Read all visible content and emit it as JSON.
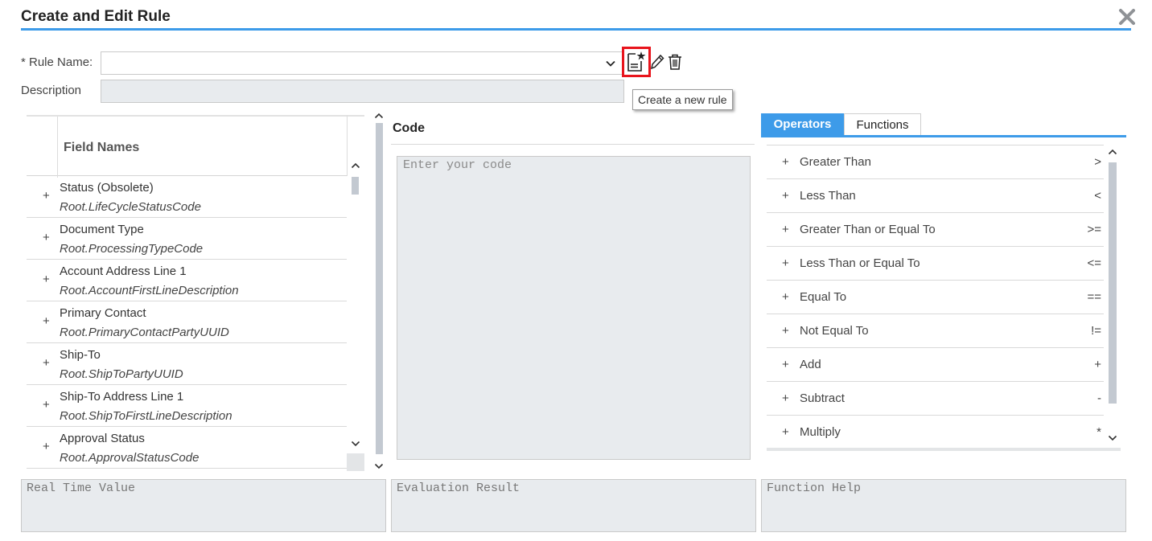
{
  "dialog": {
    "title": "Create and Edit Rule",
    "close_icon": "close-icon",
    "accent_color": "#3d9be9"
  },
  "rule_form": {
    "rule_name_label": "* Rule Name:",
    "rule_name_value": "",
    "description_label": "Description",
    "description_value": "",
    "toolbar": {
      "new_rule_icon": "new-document-icon",
      "edit_icon": "pencil-icon",
      "delete_icon": "trash-icon",
      "highlight_color": "#e8141c"
    },
    "tooltip": "Create a new rule"
  },
  "field_names": {
    "header": "Field Names",
    "rows": [
      {
        "plus": "+",
        "name": "Status (Obsolete)",
        "path": "Root.LifeCycleStatusCode"
      },
      {
        "plus": "+",
        "name": "Document Type",
        "path": "Root.ProcessingTypeCode"
      },
      {
        "plus": "+",
        "name": "Account Address Line 1",
        "path": "Root.AccountFirstLineDescription"
      },
      {
        "plus": "+",
        "name": "Primary Contact",
        "path": "Root.PrimaryContactPartyUUID"
      },
      {
        "plus": "+",
        "name": "Ship-To",
        "path": "Root.ShipToPartyUUID"
      },
      {
        "plus": "+",
        "name": "Ship-To Address Line 1",
        "path": "Root.ShipToFirstLineDescription"
      },
      {
        "plus": "+",
        "name": "Approval Status",
        "path": "Root.ApprovalStatusCode"
      }
    ]
  },
  "code": {
    "title": "Code",
    "placeholder": "Enter your code",
    "value": ""
  },
  "operators_panel": {
    "tabs": [
      {
        "label": "Operators",
        "active": true
      },
      {
        "label": "Functions",
        "active": false
      }
    ],
    "operators": [
      {
        "plus": "+",
        "name": "Greater Than",
        "symbol": ">"
      },
      {
        "plus": "+",
        "name": "Less Than",
        "symbol": "<"
      },
      {
        "plus": "+",
        "name": "Greater Than or Equal To",
        "symbol": ">="
      },
      {
        "plus": "+",
        "name": "Less Than or Equal To",
        "symbol": "<="
      },
      {
        "plus": "+",
        "name": "Equal To",
        "symbol": "=="
      },
      {
        "plus": "+",
        "name": "Not Equal To",
        "symbol": "!="
      },
      {
        "plus": "+",
        "name": "Add",
        "symbol": "+"
      },
      {
        "plus": "+",
        "name": "Subtract",
        "symbol": "-"
      },
      {
        "plus": "+",
        "name": "Multiply",
        "symbol": "*"
      }
    ]
  },
  "bottom_panels": {
    "real_time_value_placeholder": "Real Time Value",
    "evaluation_result_placeholder": "Evaluation Result",
    "function_help_placeholder": "Function Help"
  }
}
